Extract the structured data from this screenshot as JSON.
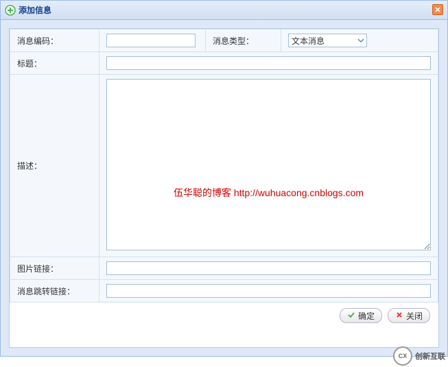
{
  "window": {
    "title": "添加信息"
  },
  "form": {
    "message_code": {
      "label": "消息编码：",
      "value": ""
    },
    "message_type": {
      "label": "消息类型：",
      "selected": "文本消息"
    },
    "title": {
      "label": "标题：",
      "value": ""
    },
    "description": {
      "label": "描述：",
      "value": ""
    },
    "image_link": {
      "label": "图片链接：",
      "value": ""
    },
    "jump_link": {
      "label": "消息跳转链接：",
      "value": ""
    }
  },
  "buttons": {
    "ok": "确定",
    "close": "关闭"
  },
  "watermark": "伍华聪的博客 http://wuhuacong.cnblogs.com",
  "footer": {
    "logo_text": "创新互联",
    "logo_sub": "CX"
  }
}
